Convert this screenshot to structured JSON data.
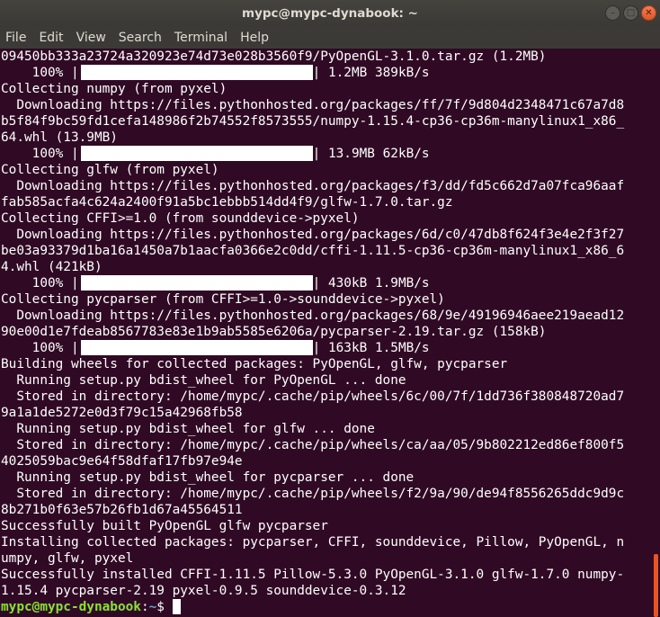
{
  "window": {
    "title": "mypc@mypc-dynabook: ~",
    "buttons": {
      "minimize": "–",
      "maximize": "□",
      "close": "✕"
    }
  },
  "menu": [
    "File",
    "Edit",
    "View",
    "Search",
    "Terminal",
    "Help"
  ],
  "lines": [
    {
      "text": "09450bb333a23724a320923e74d73e028b3560f9/PyOpenGL-3.1.0.tar.gz (1.2MB)"
    },
    {
      "progress": {
        "percent": "100%",
        "stats": "1.2MB 389kB/s"
      }
    },
    {
      "text": "Collecting numpy (from pyxel)"
    },
    {
      "text": "  Downloading https://files.pythonhosted.org/packages/ff/7f/9d804d2348471c67a7d8"
    },
    {
      "text": "b5f84f9bc59fd1cefa148986f2b74552f8573555/numpy-1.15.4-cp36-cp36m-manylinux1_x86_"
    },
    {
      "text": "64.whl (13.9MB)"
    },
    {
      "progress": {
        "percent": "100%",
        "stats": "13.9MB 62kB/s"
      }
    },
    {
      "text": "Collecting glfw (from pyxel)"
    },
    {
      "text": "  Downloading https://files.pythonhosted.org/packages/f3/dd/fd5c662d7a07fca96aaf"
    },
    {
      "text": "fab585acfa4c624a2400f91a5bc1ebbb514dd4f9/glfw-1.7.0.tar.gz"
    },
    {
      "text": "Collecting CFFI>=1.0 (from sounddevice->pyxel)"
    },
    {
      "text": "  Downloading https://files.pythonhosted.org/packages/6d/c0/47db8f624f3e4e2f3f27"
    },
    {
      "text": "be03a93379d1ba16a1450a7b1aacfa0366e2c0dd/cffi-1.11.5-cp36-cp36m-manylinux1_x86_6"
    },
    {
      "text": "4.whl (421kB)"
    },
    {
      "progress": {
        "percent": "100%",
        "stats": "430kB 1.9MB/s"
      }
    },
    {
      "text": "Collecting pycparser (from CFFI>=1.0->sounddevice->pyxel)"
    },
    {
      "text": "  Downloading https://files.pythonhosted.org/packages/68/9e/49196946aee219aead12"
    },
    {
      "text": "90e00d1e7fdeab8567783e83e1b9ab5585e6206a/pycparser-2.19.tar.gz (158kB)"
    },
    {
      "progress": {
        "percent": "100%",
        "stats": "163kB 1.5MB/s"
      }
    },
    {
      "text": "Building wheels for collected packages: PyOpenGL, glfw, pycparser"
    },
    {
      "text": "  Running setup.py bdist_wheel for PyOpenGL ... done"
    },
    {
      "text": "  Stored in directory: /home/mypc/.cache/pip/wheels/6c/00/7f/1dd736f380848720ad7"
    },
    {
      "text": "9a1a1de5272e0d3f79c15a42968fb58"
    },
    {
      "text": "  Running setup.py bdist_wheel for glfw ... done"
    },
    {
      "text": "  Stored in directory: /home/mypc/.cache/pip/wheels/ca/aa/05/9b802212ed86ef800f5"
    },
    {
      "text": "4025059bac9e64f58dfaf17fb97e94e"
    },
    {
      "text": "  Running setup.py bdist_wheel for pycparser ... done"
    },
    {
      "text": "  Stored in directory: /home/mypc/.cache/pip/wheels/f2/9a/90/de94f8556265ddc9d9c"
    },
    {
      "text": "8b271b0f63e57b26fb1d67a45564511"
    },
    {
      "text": "Successfully built PyOpenGL glfw pycparser"
    },
    {
      "text": "Installing collected packages: pycparser, CFFI, sounddevice, Pillow, PyOpenGL, n"
    },
    {
      "text": "umpy, glfw, pyxel"
    },
    {
      "text": "Successfully installed CFFI-1.11.5 Pillow-5.3.0 PyOpenGL-3.1.0 glfw-1.7.0 numpy-"
    },
    {
      "text": "1.15.4 pycparser-2.19 pyxel-0.9.5 sounddevice-0.3.12"
    }
  ],
  "prompt": {
    "user_host": "mypc@mypc-dynabook",
    "separator": ":",
    "path": "~",
    "symbol": "$ "
  },
  "colors": {
    "background": "#300a24",
    "prompt_user": "#8ae234",
    "prompt_path": "#729fcf",
    "scrollbar": "#e95420"
  }
}
